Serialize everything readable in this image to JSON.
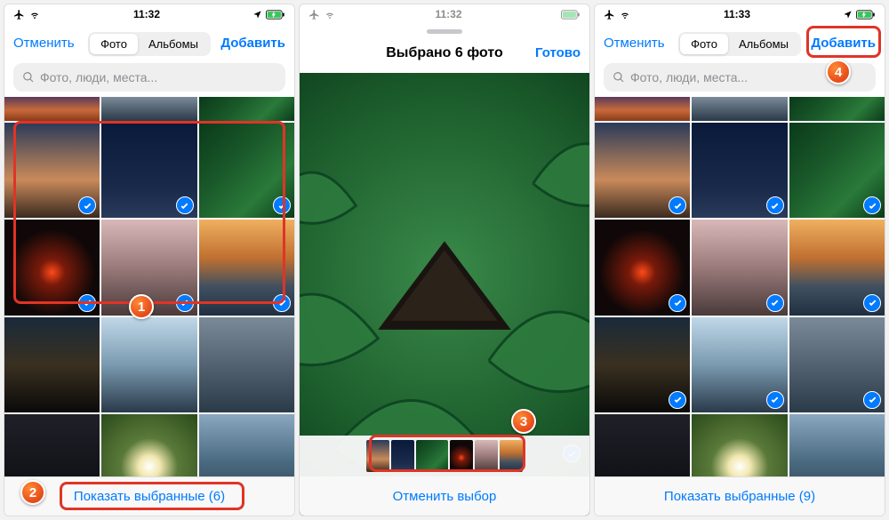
{
  "status": {
    "time_left": "11:32",
    "time_mid": "11:32",
    "time_right": "11:33"
  },
  "picker": {
    "cancel": "Отменить",
    "add": "Добавить",
    "seg_photos": "Фото",
    "seg_albums": "Альбомы",
    "search_placeholder": "Фото, люди, места..."
  },
  "preview": {
    "title": "Выбрано 6 фото",
    "done": "Готово",
    "cancel_selection": "Отменить выбор"
  },
  "bottom": {
    "show_selected_6": "Показать выбранные (6)",
    "show_selected_9": "Показать выбранные (9)"
  },
  "annotations": {
    "b1": "1",
    "b2": "2",
    "b3": "3",
    "b4": "4"
  },
  "colors": {
    "accent": "#007aff",
    "highlight": "#e03426"
  }
}
